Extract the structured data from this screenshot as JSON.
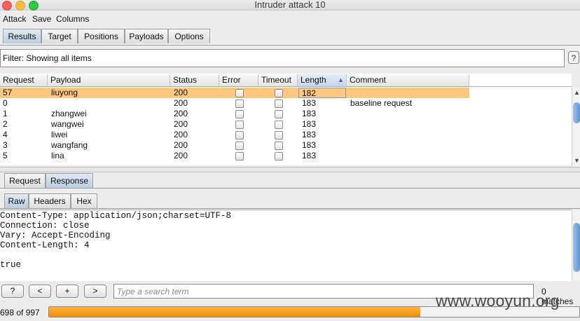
{
  "window": {
    "title": "Intruder attack 10"
  },
  "menu": [
    "Attack",
    "Save",
    "Columns"
  ],
  "tabs": [
    "Results",
    "Target",
    "Positions",
    "Payloads",
    "Options"
  ],
  "filter": {
    "text": "Filter:  Showing all items",
    "help": "?"
  },
  "table": {
    "columns": [
      "Request",
      "Payload",
      "Status",
      "Error",
      "Timeout",
      "Length",
      "Comment"
    ],
    "sort_indicator": "▲",
    "rows": [
      {
        "request": "57",
        "payload": "liuyong",
        "status": "200",
        "error": false,
        "timeout": false,
        "length": "182",
        "comment": "",
        "selected": true
      },
      {
        "request": "0",
        "payload": "",
        "status": "200",
        "error": false,
        "timeout": false,
        "length": "183",
        "comment": "baseline request"
      },
      {
        "request": "1",
        "payload": "zhangwei",
        "status": "200",
        "error": false,
        "timeout": false,
        "length": "183",
        "comment": ""
      },
      {
        "request": "2",
        "payload": "wangwei",
        "status": "200",
        "error": false,
        "timeout": false,
        "length": "183",
        "comment": ""
      },
      {
        "request": "4",
        "payload": "liwei",
        "status": "200",
        "error": false,
        "timeout": false,
        "length": "183",
        "comment": ""
      },
      {
        "request": "3",
        "payload": "wangfang",
        "status": "200",
        "error": false,
        "timeout": false,
        "length": "183",
        "comment": ""
      },
      {
        "request": "5",
        "payload": "lina",
        "status": "200",
        "error": false,
        "timeout": false,
        "length": "183",
        "comment": ""
      }
    ]
  },
  "message_tabs": [
    "Request",
    "Response"
  ],
  "view_tabs": [
    "Raw",
    "Headers",
    "Hex"
  ],
  "response": {
    "lines": [
      "Content-Type: application/json;charset=UTF-8",
      "Connection: close",
      "Vary: Accept-Encoding",
      "Content-Length: 4",
      "",
      "true"
    ]
  },
  "search": {
    "buttons": [
      "?",
      "<",
      "+",
      ">"
    ],
    "placeholder": "Type a search term",
    "matches": "0 matches"
  },
  "progress": {
    "text": "698 of 997",
    "done": 698,
    "total": 997
  },
  "watermark": "www.wooyun.org",
  "colors": {
    "selected_row": "#fcc77e",
    "progress": "#f08a00",
    "selected_tab": "#b9cde2"
  }
}
